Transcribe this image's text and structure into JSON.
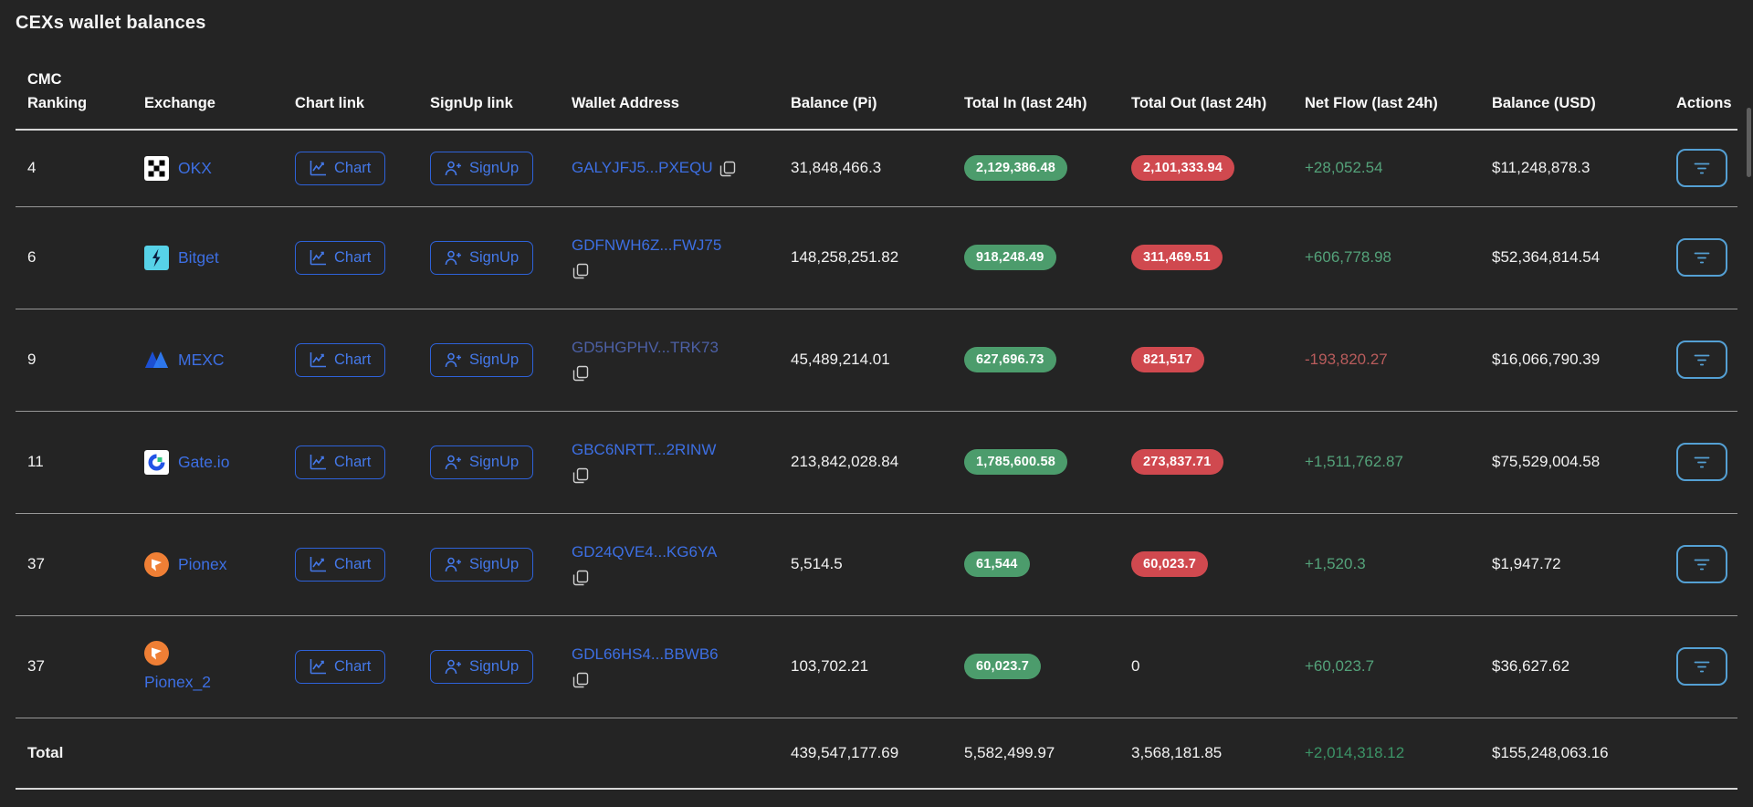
{
  "title": "CEXs wallet balances",
  "header": {
    "ranking": "CMC Ranking",
    "exchange": "Exchange",
    "chart": "Chart link",
    "signup": "SignUp link",
    "wallet": "Wallet Address",
    "balance_pi": "Balance (Pi)",
    "total_in": "Total In (last 24h)",
    "total_out": "Total Out (last 24h)",
    "net_flow": "Net Flow (last 24h)",
    "balance_usd": "Balance (USD)",
    "actions": "Actions"
  },
  "buttons": {
    "chart_label": "Chart",
    "signup_label": "SignUp"
  },
  "rows": [
    {
      "ranking": "4",
      "exchange": "OKX",
      "wallet": "GALYJFJ5...PXEQU",
      "balance_pi": "31,848,466.3",
      "total_in": "2,129,386.48",
      "total_out": "2,101,333.94",
      "net_flow": "+28,052.54",
      "balance_usd": "$11,248,878.3"
    },
    {
      "ranking": "6",
      "exchange": "Bitget",
      "wallet": "GDFNWH6Z...FWJ75",
      "balance_pi": "148,258,251.82",
      "total_in": "918,248.49",
      "total_out": "311,469.51",
      "net_flow": "+606,778.98",
      "balance_usd": "$52,364,814.54"
    },
    {
      "ranking": "9",
      "exchange": "MEXC",
      "wallet": "GD5HGPHV...TRK73",
      "balance_pi": "45,489,214.01",
      "total_in": "627,696.73",
      "total_out": "821,517",
      "net_flow": "-193,820.27",
      "balance_usd": "$16,066,790.39"
    },
    {
      "ranking": "11",
      "exchange": "Gate.io",
      "wallet": "GBC6NRTT...2RINW",
      "balance_pi": "213,842,028.84",
      "total_in": "1,785,600.58",
      "total_out": "273,837.71",
      "net_flow": "+1,511,762.87",
      "balance_usd": "$75,529,004.58"
    },
    {
      "ranking": "37",
      "exchange": "Pionex",
      "wallet": "GD24QVE4...KG6YA",
      "balance_pi": "5,514.5",
      "total_in": "61,544",
      "total_out": "60,023.7",
      "net_flow": "+1,520.3",
      "balance_usd": "$1,947.72"
    },
    {
      "ranking": "37",
      "exchange": "Pionex_2",
      "wallet": "GDL66HS4...BBWB6",
      "balance_pi": "103,702.21",
      "total_in": "60,023.7",
      "total_out": "0",
      "net_flow": "+60,023.7",
      "balance_usd": "$36,627.62"
    }
  ],
  "total": {
    "label": "Total",
    "balance_pi": "439,547,177.69",
    "total_in": "5,582,499.97",
    "total_out": "3,568,181.85",
    "net_flow": "+2,014,318.12",
    "balance_usd": "$155,248,063.16"
  },
  "icons": {
    "chart": "chart-line-icon",
    "signup": "person-plus-icon",
    "copy": "copy-icon",
    "actions": "filter-icon"
  },
  "colors": {
    "background": "#242424",
    "link_blue": "#3d6fe3",
    "button_blue": "#2e62d9",
    "pill_green": "#4c9c6c",
    "pill_red": "#d0494f",
    "flow_green": "#54a27a",
    "flow_red": "#b95c5c",
    "actions_blue": "#54a0d4",
    "separator": "#979797"
  }
}
